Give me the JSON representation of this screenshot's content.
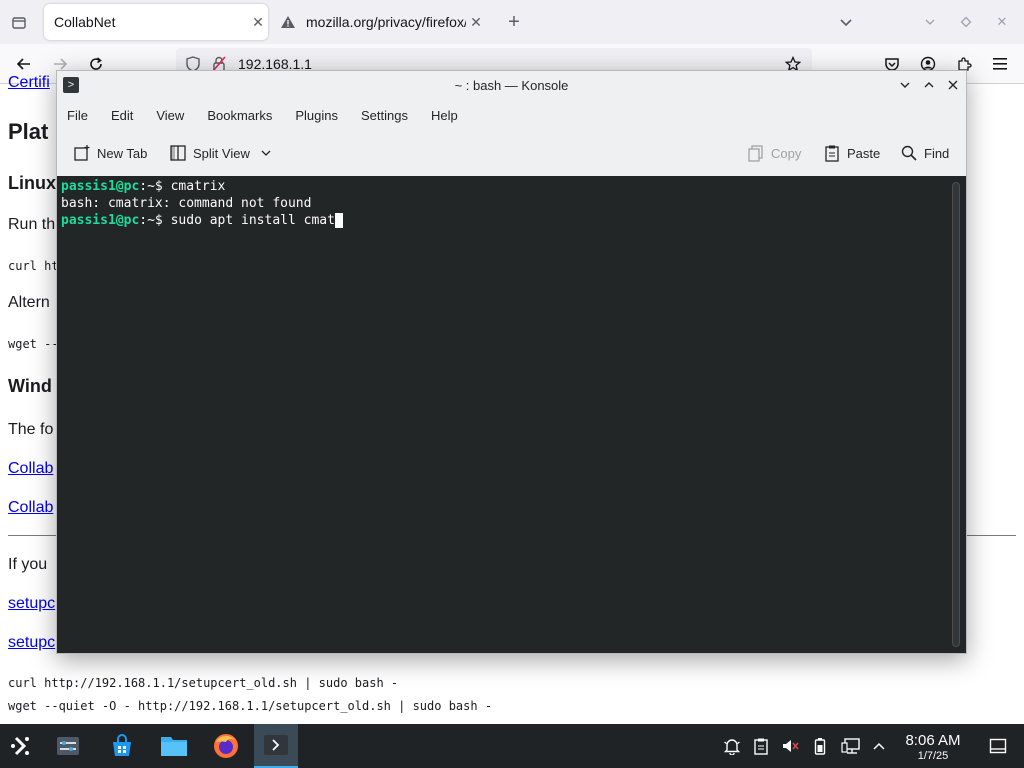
{
  "browser": {
    "tabs": [
      {
        "title": "CollabNet",
        "active": true
      },
      {
        "title": "mozilla.org/privacy/firefox/",
        "active": false
      }
    ],
    "url": "192.168.1.1",
    "new_tab_symbol": "+"
  },
  "page": {
    "partial_texts": {
      "certificate_link": "Certifi",
      "heading_platform": "Plat",
      "heading_linux": "Linux",
      "run_text": "Run th",
      "curl_partial": "curl ht",
      "alternatively_text": "Altern",
      "wget_partial": "wget --",
      "heading_windows": "Wind",
      "following_text": "The fo",
      "collab_link_1": "Collab",
      "collab_link_2": "Collab",
      "if_you_text": "If you",
      "setup_link_1": "setupc",
      "setup_link_2": "setupc"
    },
    "curl_old_cmd": "curl http://192.168.1.1/setupcert_old.sh | sudo bash -",
    "wget_old_cmd": "wget --quiet -O - http://192.168.1.1/setupcert_old.sh | sudo bash -"
  },
  "konsole": {
    "title": "~ : bash — Konsole",
    "menu": [
      "File",
      "Edit",
      "View",
      "Bookmarks",
      "Plugins",
      "Settings",
      "Help"
    ],
    "toolbar": {
      "new_tab": "New Tab",
      "split_view": "Split View",
      "copy": "Copy",
      "paste": "Paste",
      "find": "Find"
    },
    "terminal": {
      "lines": [
        {
          "prompt": "passis1@pc",
          "sep": ":~$ ",
          "text": "cmatrix"
        },
        {
          "prompt": "",
          "sep": "",
          "text": "bash: cmatrix: command not found"
        },
        {
          "prompt": "passis1@pc",
          "sep": ":~$ ",
          "text": "sudo apt install cmat"
        }
      ]
    }
  },
  "taskbar": {
    "clock_time": "8:06 AM",
    "clock_date": "1/7/25"
  },
  "colors": {
    "terminal_bg": "#232627",
    "prompt_green": "#1cdc9a",
    "taskbar_bg": "#202326",
    "link_blue": "#0000ee"
  }
}
